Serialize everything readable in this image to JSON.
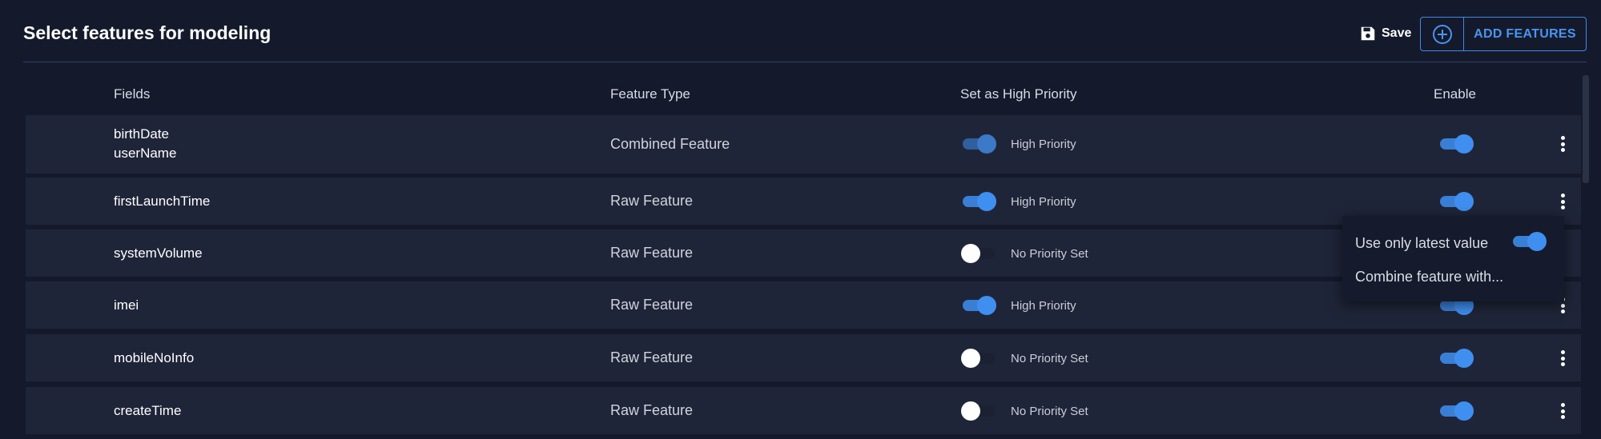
{
  "header": {
    "title": "Select features for modeling",
    "save_label": "Save",
    "save_icon": "floppy-disk-icon",
    "add_label": "ADD FEATURES",
    "add_icon": "plus-circle-icon"
  },
  "table": {
    "columns": {
      "fields": "Fields",
      "feature_type": "Feature Type",
      "priority": "Set as High Priority",
      "enable": "Enable"
    },
    "rows": [
      {
        "fields": [
          "birthDate",
          "userName"
        ],
        "feature_type": "Combined Feature",
        "priority_on": true,
        "priority_label": "High Priority",
        "enabled": true
      },
      {
        "fields": [
          "firstLaunchTime"
        ],
        "feature_type": "Raw Feature",
        "priority_on": true,
        "priority_label": "High Priority",
        "enabled": true
      },
      {
        "fields": [
          "systemVolume"
        ],
        "feature_type": "Raw Feature",
        "priority_on": false,
        "priority_label": "No Priority Set",
        "enabled": true
      },
      {
        "fields": [
          "imei"
        ],
        "feature_type": "Raw Feature",
        "priority_on": true,
        "priority_label": "High Priority",
        "enabled": true
      },
      {
        "fields": [
          "mobileNoInfo"
        ],
        "feature_type": "Raw Feature",
        "priority_on": false,
        "priority_label": "No Priority Set",
        "enabled": true
      },
      {
        "fields": [
          "createTime"
        ],
        "feature_type": "Raw Feature",
        "priority_on": false,
        "priority_label": "No Priority Set",
        "enabled": true
      }
    ]
  },
  "menu": {
    "latest_value_label": "Use only latest value",
    "latest_value_on": true,
    "combine_label": "Combine feature with..."
  },
  "colors": {
    "background": "#141a2b",
    "row": "#1f2538",
    "accent": "#3f88e6"
  }
}
